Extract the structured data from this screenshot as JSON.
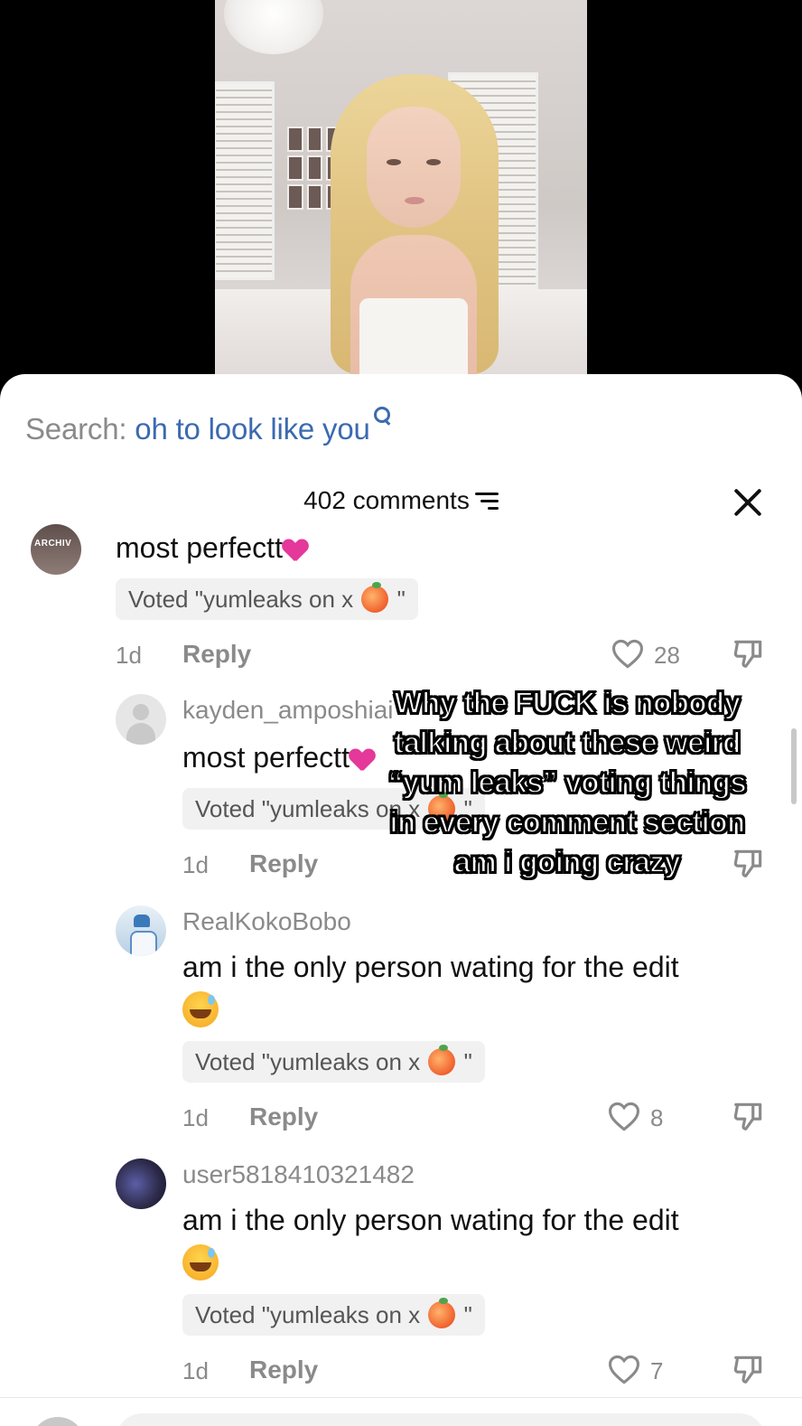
{
  "search": {
    "label": "Search:",
    "query": "oh to look like you"
  },
  "comments_header": {
    "count": "402 comments"
  },
  "overlay_caption": "Why the FUCK is nobody talking about these weird “yum leaks” voting things in every comment section am i going crazy",
  "comments": [
    {
      "username": "",
      "avatar_text": "ARCHIV",
      "text": "most perfectt",
      "voted_prefix": "Voted \"yumleaks on x",
      "voted_suffix": "\"",
      "time": "1d",
      "reply_label": "Reply",
      "likes": "28"
    },
    {
      "username": "kayden_amposhiai",
      "text": "most perfectt",
      "voted_prefix": "Voted \"yumleaks on x",
      "voted_suffix": "\"",
      "time": "1d",
      "reply_label": "Reply",
      "likes": ""
    },
    {
      "username": "RealKokoBobo",
      "text": "am i the only person wating for the edit",
      "voted_prefix": "Voted \"yumleaks on x",
      "voted_suffix": "\"",
      "time": "1d",
      "reply_label": "Reply",
      "likes": "8"
    },
    {
      "username": "user5818410321482",
      "text": "am i the only person wating for the edit",
      "voted_prefix": "Voted \"yumleaks on x",
      "voted_suffix": "\"",
      "time": "1d",
      "reply_label": "Reply",
      "likes": "7"
    }
  ],
  "icons": {
    "search": "search-icon",
    "filter": "filter-icon",
    "close": "close-icon",
    "like": "heart-icon",
    "dislike": "dislike-icon",
    "emoji_heart": "pink-heart-emoji",
    "emoji_peach": "peach-emoji",
    "emoji_sweat": "sweat-smile-emoji"
  },
  "colors": {
    "accent_query": "#3b6ab0",
    "muted_text": "#8a8a8a",
    "heart_emoji": "#e4389a"
  }
}
